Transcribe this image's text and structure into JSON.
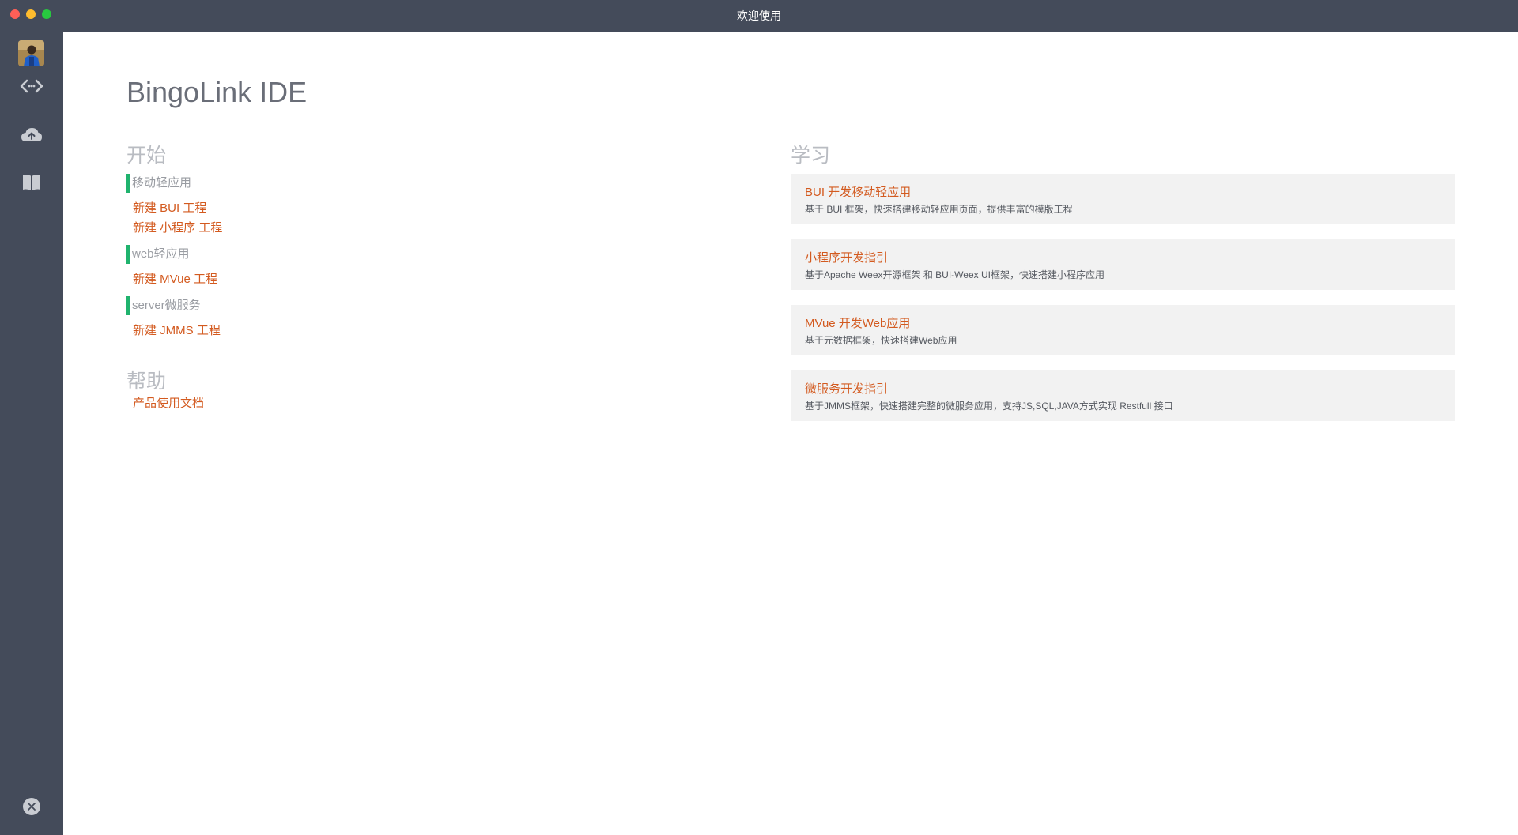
{
  "window": {
    "title": "欢迎使用"
  },
  "sidebar": {
    "icons": [
      "avatar",
      "code-icon",
      "cloud-upload-icon",
      "book-icon",
      "close-circle-icon"
    ]
  },
  "main": {
    "app_title": "BingoLink IDE",
    "start": {
      "heading": "开始",
      "groups": [
        {
          "label": "移动轻应用",
          "links": [
            "新建 BUI 工程",
            "新建 小程序 工程"
          ]
        },
        {
          "label": "web轻应用",
          "links": [
            "新建 MVue 工程"
          ]
        },
        {
          "label": "server微服务",
          "links": [
            "新建 JMMS 工程"
          ]
        }
      ]
    },
    "help": {
      "heading": "帮助",
      "links": [
        "产品使用文档"
      ]
    },
    "learn": {
      "heading": "学习",
      "cards": [
        {
          "title": "BUI 开发移动轻应用",
          "desc": "基于 BUI 框架，快速搭建移动轻应用页面，提供丰富的模版工程"
        },
        {
          "title": "小程序开发指引",
          "desc": "基于Apache Weex开源框架 和 BUI-Weex UI框架，快速搭建小程序应用"
        },
        {
          "title": "MVue 开发Web应用",
          "desc": "基于元数据框架，快速搭建Web应用"
        },
        {
          "title": "微服务开发指引",
          "desc": "基于JMMS框架，快速搭建完整的微服务应用，支持JS,SQL,JAVA方式实现 Restfull 接口"
        }
      ]
    }
  },
  "colors": {
    "chrome": "#444b5a",
    "link": "#d35a1f",
    "accent_bar": "#20b36e",
    "card_bg": "#f2f2f2"
  }
}
